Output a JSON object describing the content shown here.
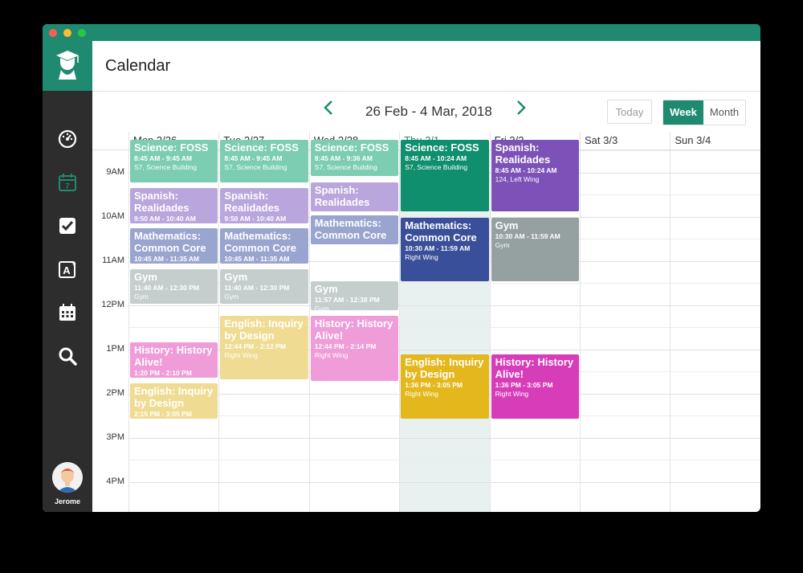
{
  "app": {
    "title": "Calendar",
    "user_name": "Jerome"
  },
  "sidebar": {
    "items": [
      {
        "name": "dashboard",
        "icon": "speedometer-icon"
      },
      {
        "name": "calendar",
        "icon": "calendar-day-icon",
        "day": "7"
      },
      {
        "name": "tasks",
        "icon": "checkbox-icon"
      },
      {
        "name": "grades",
        "icon": "grade-icon",
        "label": "A"
      },
      {
        "name": "schedule",
        "icon": "calendar-grid-icon"
      },
      {
        "name": "search",
        "icon": "search-icon"
      }
    ]
  },
  "toolbar": {
    "date_range": "26 Feb - 4 Mar, 2018",
    "prev_icon": "chevron-left-icon",
    "next_icon": "chevron-right-icon",
    "today_label": "Today",
    "week_label": "Week",
    "month_label": "Month",
    "active_view": "Week"
  },
  "days": [
    "Mon 2/26",
    "Tue 2/27",
    "Wed 2/28",
    "Thu 3/1",
    "Fri 3/2",
    "Sat 3/3",
    "Sun 3/4"
  ],
  "today_index": 3,
  "times": [
    "9AM",
    "10AM",
    "11AM",
    "12PM",
    "1PM",
    "2PM",
    "3PM",
    "4PM"
  ],
  "colors": {
    "brand": "#1f8a70",
    "science": "#7ccdb1",
    "science_active": "#0f8f6d",
    "spanish": "#b8a6dc",
    "spanish_active": "#7c52b8",
    "math": "#9aa5cf",
    "math_active": "#3a4f9a",
    "gym": "#c5cdcd",
    "gym_active": "#95a0a0",
    "english": "#efdc92",
    "english_active": "#e4b81d",
    "history": "#ef9cd8",
    "history_active": "#d73db8"
  },
  "events": [
    {
      "day": 0,
      "start": 8.75,
      "end": 9.75,
      "title": "Science: FOSS",
      "time": "8:45 AM - 9:45 AM",
      "location": "S7, Science Building",
      "color": "#7ccdb1"
    },
    {
      "day": 0,
      "start": 9.833,
      "end": 10.667,
      "title": "Spanish: Realidades",
      "time": "9:50 AM - 10:40 AM",
      "location": "",
      "color": "#b8a6dc"
    },
    {
      "day": 0,
      "start": 10.75,
      "end": 11.583,
      "title": "Mathematics: Common Core",
      "time": "10:45 AM - 11:35 AM",
      "location": "",
      "color": "#9aa5cf"
    },
    {
      "day": 0,
      "start": 11.667,
      "end": 12.5,
      "title": "Gym",
      "time": "11:40 AM - 12:30 PM",
      "location": "Gym",
      "color": "#c5cdcd"
    },
    {
      "day": 0,
      "start": 13.333,
      "end": 14.167,
      "title": "History: History Alive!",
      "time": "1:20 PM - 2:10 PM",
      "location": "",
      "color": "#ef9cd8"
    },
    {
      "day": 0,
      "start": 14.25,
      "end": 15.083,
      "title": "English: Inquiry by Design",
      "time": "2:15 PM - 3:05 PM",
      "location": "",
      "color": "#efdc92"
    },
    {
      "day": 1,
      "start": 8.75,
      "end": 9.75,
      "title": "Science: FOSS",
      "time": "8:45 AM - 9:45 AM",
      "location": "S7, Science Building",
      "color": "#7ccdb1"
    },
    {
      "day": 1,
      "start": 9.833,
      "end": 10.667,
      "title": "Spanish: Realidades",
      "time": "9:50 AM - 10:40 AM",
      "location": "",
      "color": "#b8a6dc"
    },
    {
      "day": 1,
      "start": 10.75,
      "end": 11.583,
      "title": "Mathematics: Common Core",
      "time": "10:45 AM - 11:35 AM",
      "location": "",
      "color": "#9aa5cf"
    },
    {
      "day": 1,
      "start": 11.667,
      "end": 12.5,
      "title": "Gym",
      "time": "11:40 AM - 12:30 PM",
      "location": "Gym",
      "color": "#c5cdcd"
    },
    {
      "day": 1,
      "start": 12.733,
      "end": 14.2,
      "title": "English: Inquiry by Design",
      "time": "12:44 PM - 2:12 PM",
      "location": "Right Wing",
      "color": "#efdc92"
    },
    {
      "day": 2,
      "start": 8.75,
      "end": 9.6,
      "title": "Science: FOSS",
      "time": "8:45 AM - 9:36 AM",
      "location": "S7, Science Building",
      "color": "#7ccdb1"
    },
    {
      "day": 2,
      "start": 9.7,
      "end": 10.4,
      "title": "Spanish: Realidades",
      "time": "",
      "location": "",
      "color": "#b8a6dc"
    },
    {
      "day": 2,
      "start": 10.45,
      "end": 11.15,
      "title": "Mathematics: Common Core",
      "time": "",
      "location": "",
      "color": "#9aa5cf"
    },
    {
      "day": 2,
      "start": 11.95,
      "end": 12.633,
      "title": "Gym",
      "time": "11:57 AM - 12:38 PM",
      "location": "Gym",
      "color": "#c5cdcd"
    },
    {
      "day": 2,
      "start": 12.733,
      "end": 14.233,
      "title": "History: History Alive!",
      "time": "12:44 PM - 2:14 PM",
      "location": "Right Wing",
      "color": "#ef9cd8"
    },
    {
      "day": 3,
      "start": 8.75,
      "end": 10.4,
      "title": "Science: FOSS",
      "time": "8:45 AM - 10:24 AM",
      "location": "S7, Science Building",
      "color": "#0f8f6d"
    },
    {
      "day": 3,
      "start": 10.5,
      "end": 11.983,
      "title": "Mathematics: Common Core",
      "time": "10:30 AM - 11:59 AM",
      "location": "Right Wing",
      "color": "#3a4f9a"
    },
    {
      "day": 3,
      "start": 13.6,
      "end": 15.083,
      "title": "English: Inquiry by Design",
      "time": "1:36 PM - 3:05 PM",
      "location": "Right Wing",
      "color": "#e4b81d"
    },
    {
      "day": 4,
      "start": 8.75,
      "end": 10.4,
      "title": "Spanish: Realidades",
      "time": "8:45 AM - 10:24 AM",
      "location": "124, Left Wing",
      "color": "#7c52b8"
    },
    {
      "day": 4,
      "start": 10.5,
      "end": 11.983,
      "title": "Gym",
      "time": "10:30 AM - 11:59 AM",
      "location": "Gym",
      "color": "#95a0a0"
    },
    {
      "day": 4,
      "start": 13.6,
      "end": 15.083,
      "title": "History: History Alive!",
      "time": "1:36 PM - 3:05 PM",
      "location": "Right Wing",
      "color": "#d73db8"
    }
  ]
}
